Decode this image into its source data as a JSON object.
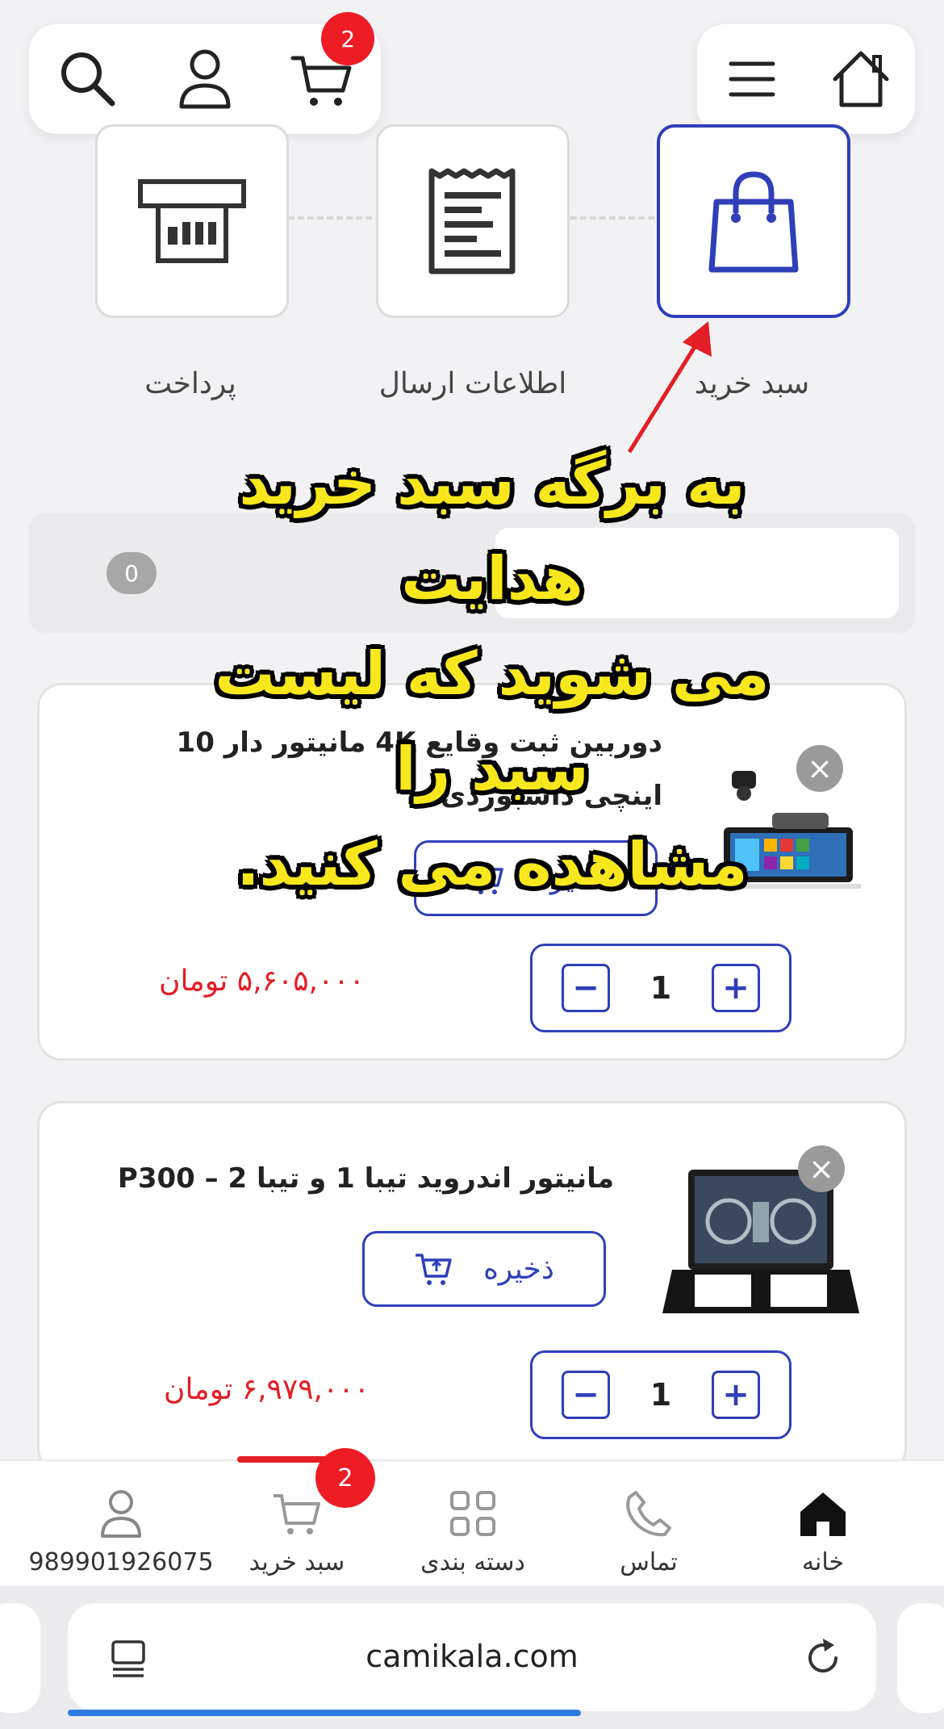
{
  "top_bar": {
    "cart_badge": "2",
    "icons": [
      "search-icon",
      "user-icon",
      "cart-icon",
      "menu-icon",
      "home-icon"
    ]
  },
  "steps": [
    {
      "label": "سبد خرید",
      "icon": "shopping-bag-icon",
      "active": true
    },
    {
      "label": "اطلاعات ارسال",
      "icon": "receipt-icon",
      "active": false
    },
    {
      "label": "پرداخت",
      "icon": "payment-icon",
      "active": false
    }
  ],
  "annotation": {
    "lines": [
      "به برگه سبد خرید هدایت",
      "می شوید که لیست سبد را",
      "مشاهده می کنید."
    ]
  },
  "summary": {
    "count": "0"
  },
  "cart_items": [
    {
      "title_line1": "دوربین ثبت وقایع 4K مانیتور دار 10",
      "title_line2": "اینچی داشبوردی",
      "save_label": "ذخیره",
      "quantity": "1",
      "price": "۵,۶۰۵,۰۰۰ تومان"
    },
    {
      "title_line1": "مانیتور اندروید تیبا 1 و تیبا 2 – P300",
      "title_line2": "",
      "save_label": "ذخیره",
      "quantity": "1",
      "price": "۶,۹۷۹,۰۰۰ تومان"
    }
  ],
  "bottom_nav": {
    "items": [
      {
        "label": "خانه",
        "icon": "home-icon"
      },
      {
        "label": "تماس",
        "icon": "phone-icon"
      },
      {
        "label": "دسته بندی",
        "icon": "grid-icon"
      },
      {
        "label": "سبد خرید",
        "icon": "cart-icon",
        "badge": "2"
      },
      {
        "label": "989901926075",
        "icon": "user-icon"
      }
    ]
  },
  "browser": {
    "url": "camikala.com"
  },
  "colors": {
    "primary": "#2f3fb8",
    "price": "#e31e24",
    "badge": "#ee1c25",
    "annotation": "#f8e71c"
  }
}
